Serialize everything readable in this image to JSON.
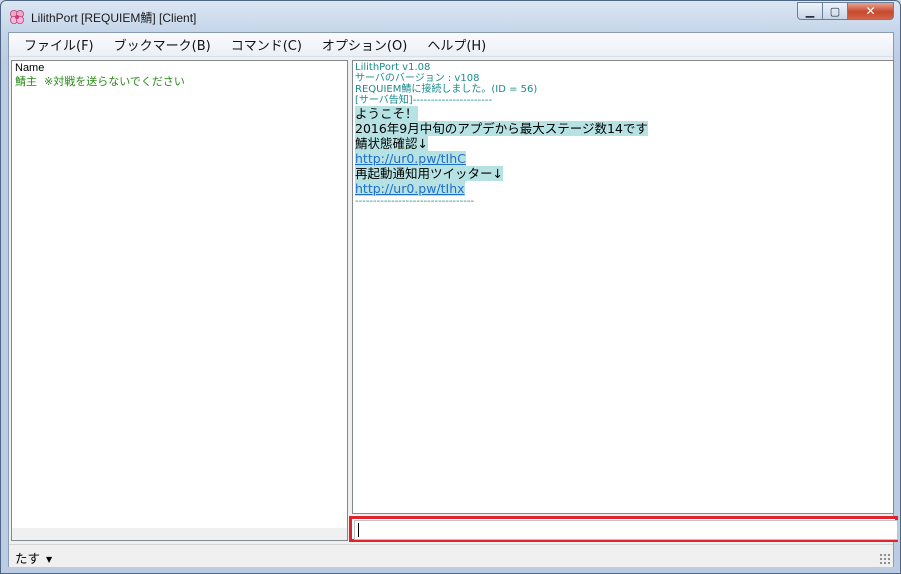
{
  "window": {
    "title": "LilithPort  [REQUIEM鯖] [Client]",
    "icon": "lilithport-app-icon"
  },
  "menu": {
    "items": [
      {
        "label": "ファイル(F)"
      },
      {
        "label": "ブックマーク(B)"
      },
      {
        "label": "コマンド(C)"
      },
      {
        "label": "オプション(O)"
      },
      {
        "label": "ヘルプ(H)"
      }
    ]
  },
  "user_list": {
    "header": "Name",
    "rows": [
      {
        "name": "鯖主",
        "comment": "※対戦を送らないでください"
      }
    ]
  },
  "log": {
    "system_lines": [
      "LilithPort v1.08",
      "サーバのバージョン : v108",
      "REQUIEM鯖に接続しました。(ID = 56)",
      "[サーバ告知]----------------------"
    ],
    "notice": [
      {
        "type": "msg",
        "text": "ようこそ！"
      },
      {
        "type": "msg",
        "text": "2016年9月中旬のアプデから最大ステージ数14です"
      },
      {
        "type": "msg",
        "text": "鯖状態確認↓"
      },
      {
        "type": "link",
        "text": "http://ur0.pw/tIhC"
      },
      {
        "type": "msg",
        "text": "再起動通知用ツイッター↓"
      },
      {
        "type": "link",
        "text": "http://ur0.pw/tIhx"
      }
    ],
    "separator": "---------------------------------"
  },
  "chat_input": {
    "value": "",
    "highlight_color": "#e0242b"
  },
  "status": {
    "dropdown_value": "たす"
  },
  "colors": {
    "system_text": "#1a8b8b",
    "user_comment": "#2a8a1a",
    "link": "#1e6fc7",
    "highlight_bg": "#b7e2e4"
  }
}
